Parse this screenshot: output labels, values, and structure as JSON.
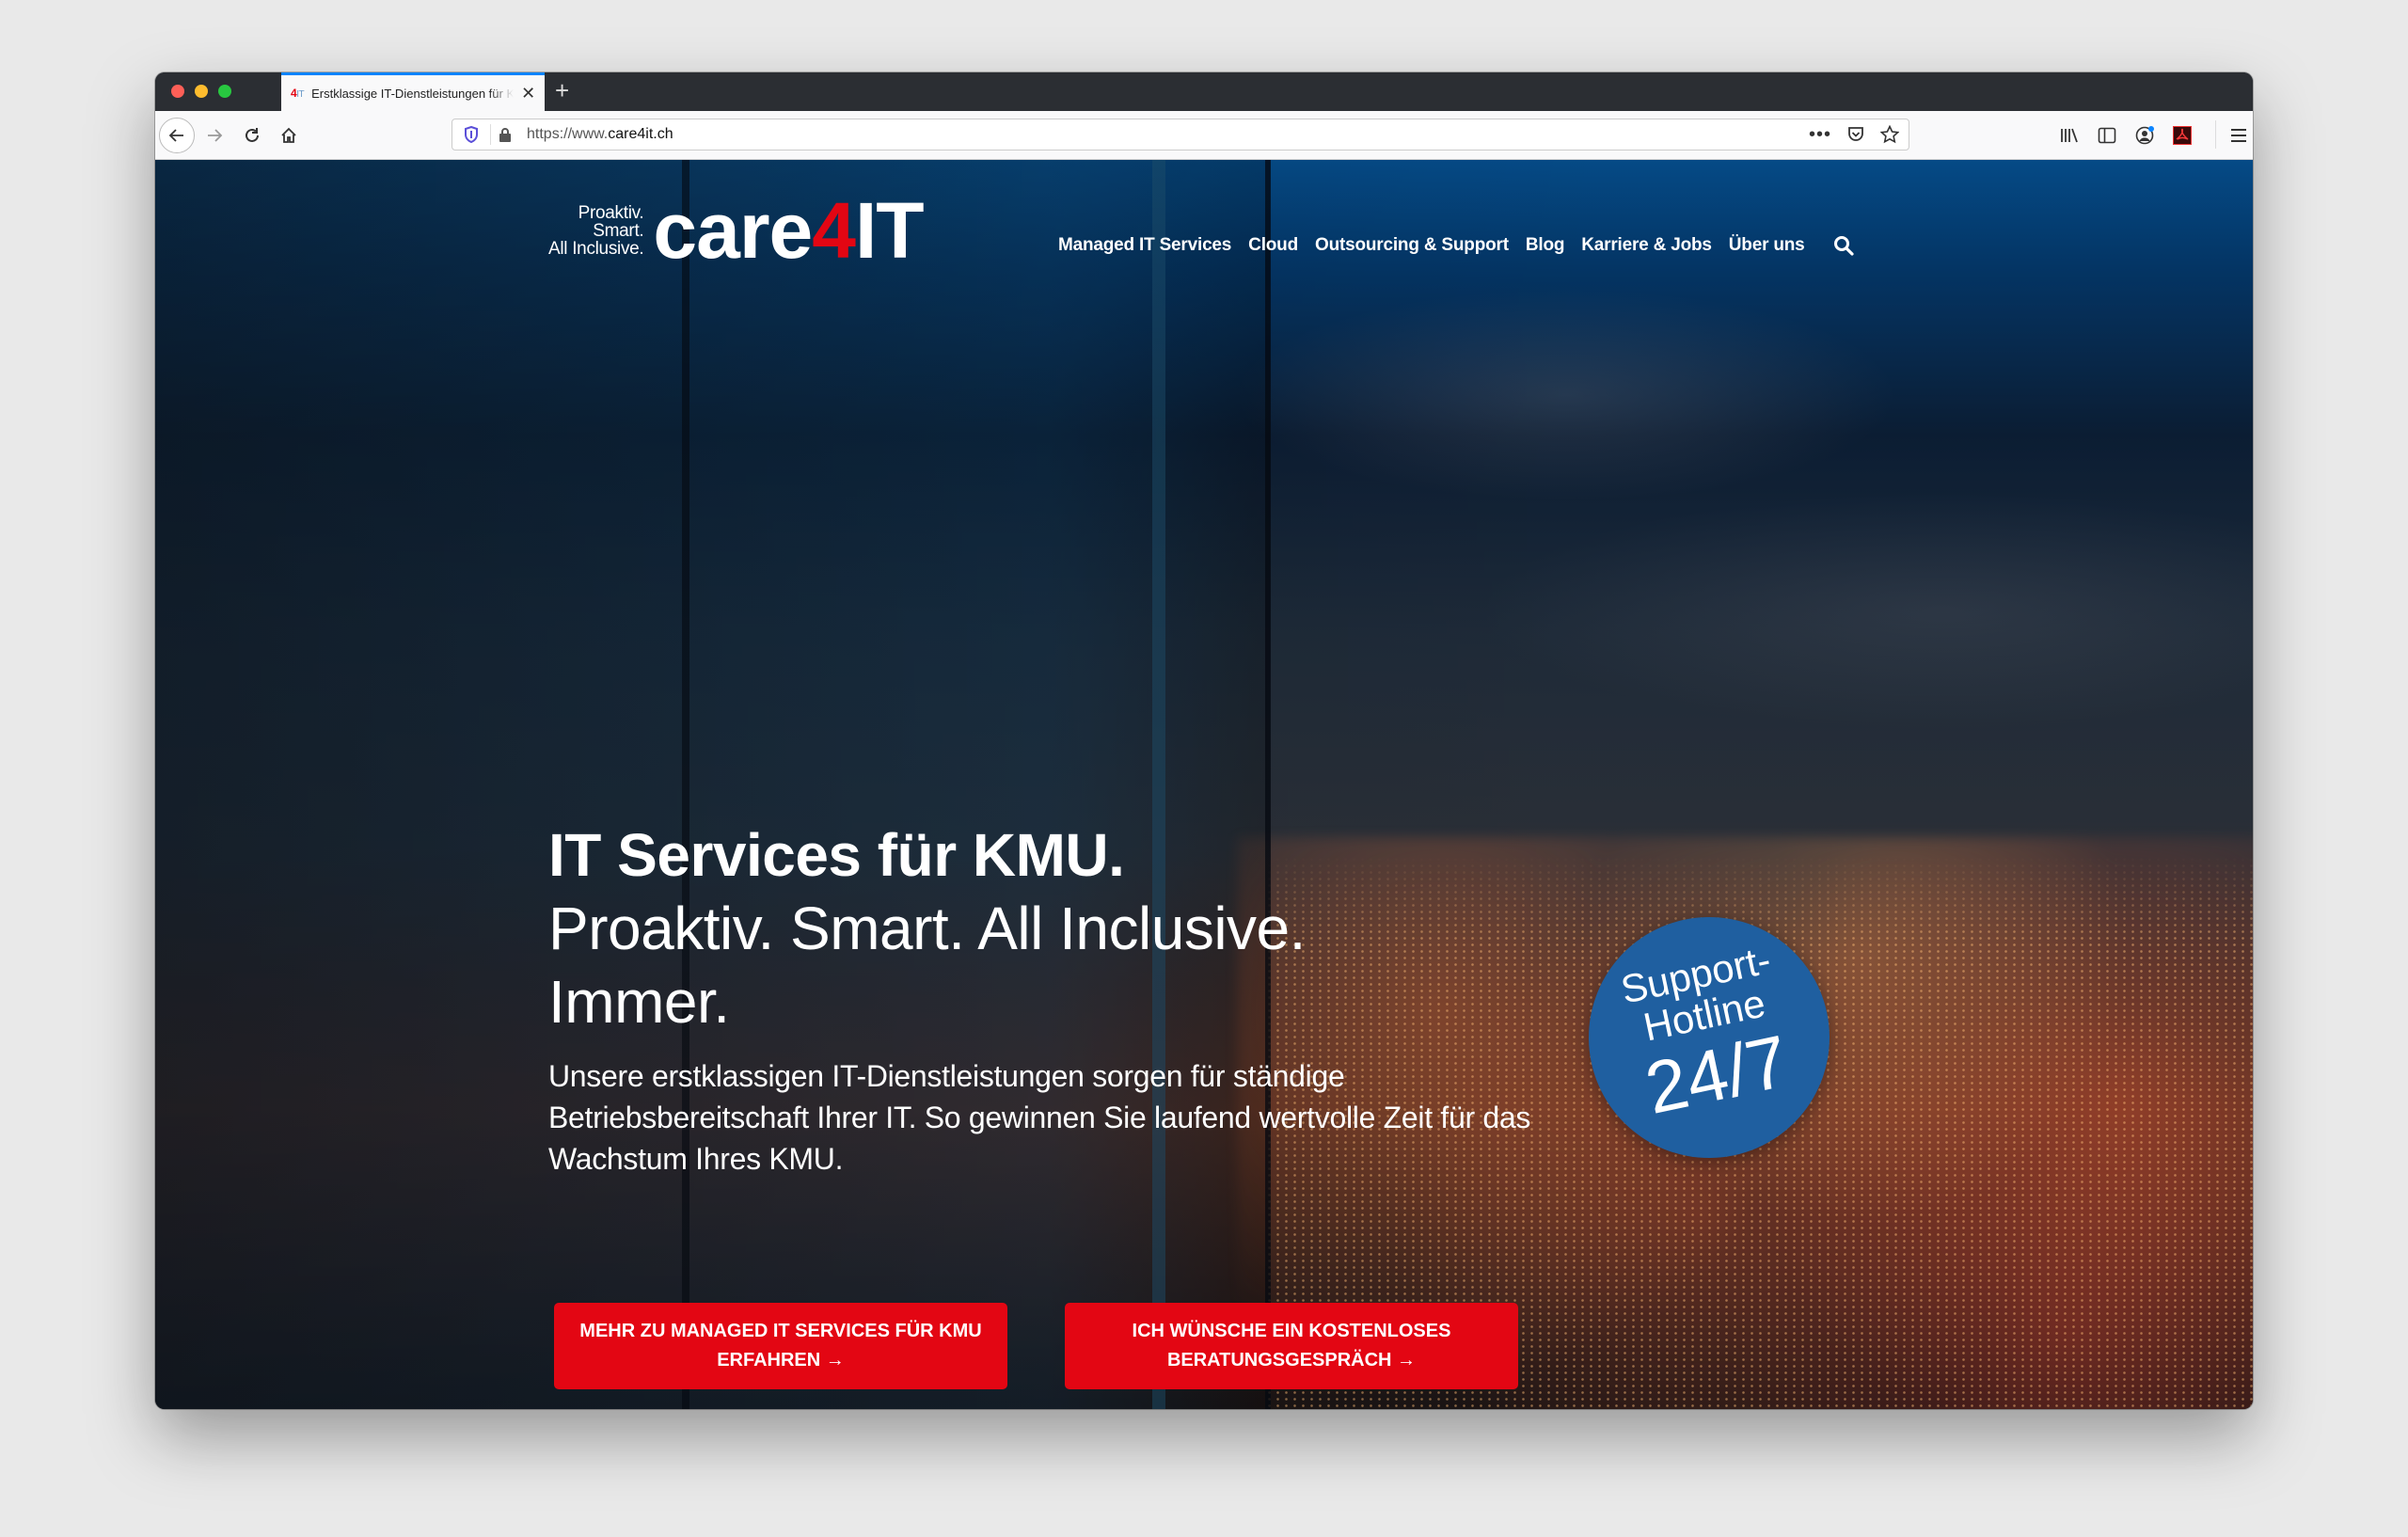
{
  "browser": {
    "tab": {
      "favicon_main": "4",
      "favicon_suffix": "IT",
      "title": "Erstklassige IT-Dienstleistungen für KMU",
      "close_label": "✕"
    },
    "new_tab_label": "+",
    "url_prefix": "https://www.",
    "url_domain": "care4it.ch",
    "icons": {
      "back": "back-arrow-icon",
      "forward": "forward-arrow-icon",
      "reload": "reload-icon",
      "home": "home-icon",
      "tracking_shield": "shield-icon",
      "lock": "lock-icon",
      "page_actions": "more-icon",
      "pocket": "pocket-icon",
      "bookmark": "star-icon",
      "library": "library-icon",
      "sidebar": "sidebar-icon",
      "account": "account-icon",
      "pdf_extension": "acrobat-icon",
      "menu": "hamburger-menu-icon"
    }
  },
  "site": {
    "logo": {
      "tagline": [
        "Proaktiv.",
        "Smart.",
        "All Inclusive."
      ],
      "word_before": "care",
      "word_accent": "4",
      "word_after": "IT"
    },
    "nav": [
      {
        "label": "Managed IT Services"
      },
      {
        "label": "Cloud"
      },
      {
        "label": "Outsourcing & Support"
      },
      {
        "label": "Blog"
      },
      {
        "label": "Karriere & Jobs"
      },
      {
        "label": "Über uns"
      }
    ],
    "hero": {
      "title_lines": [
        "IT Services für KMU.",
        "Proaktiv. Smart. All Inclusive.",
        "Immer."
      ],
      "text": "Unsere erstklassigen IT-Dienstleistungen sorgen für ständige Betriebsbereitschaft Ihrer IT. So gewinnen Sie laufend wertvolle Zeit für das Wachstum Ihres KMU.",
      "cta_primary": [
        "MEHR ZU MANAGED IT SERVICES FÜR KMU",
        "ERFAHREN →"
      ],
      "cta_secondary": [
        "ICH WÜNSCHE EIN KOSTENLOSES",
        "BERATUNGSGESPRÄCH →"
      ]
    },
    "badge": {
      "line1": "Support-",
      "line2": "Hotline",
      "line3": "24/7"
    },
    "colors": {
      "accent_red": "#e30613",
      "badge_blue": "#1f5fa0",
      "header_blue": "#054a86"
    }
  }
}
